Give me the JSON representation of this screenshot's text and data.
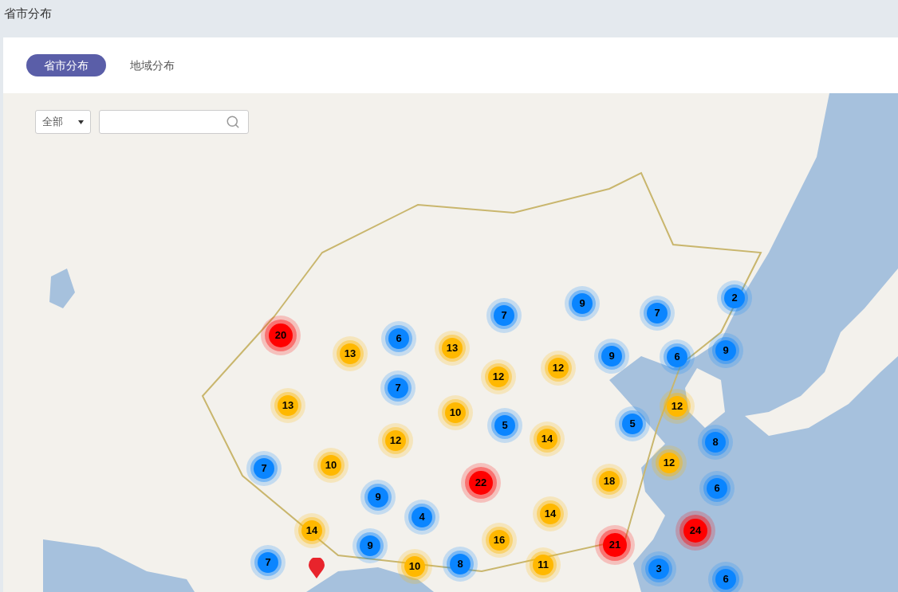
{
  "page_title": "省市分布",
  "tabs": [
    {
      "label": "省市分布",
      "selected": true
    },
    {
      "label": "地域分布",
      "selected": false
    }
  ],
  "map": {
    "region_select": "全部",
    "clusters": [
      {
        "count": "9",
        "color": "#0a85ff"
      },
      {
        "count": "7",
        "color": "#0a85ff"
      },
      {
        "count": "2",
        "color": "#0a85ff"
      },
      {
        "count": "7",
        "color": "#0a85ff"
      },
      {
        "count": "20",
        "color": "#ff0000"
      },
      {
        "count": "6",
        "color": "#0a85ff"
      },
      {
        "count": "13",
        "color": "#ffb800"
      },
      {
        "count": "13",
        "color": "#ffb800"
      },
      {
        "count": "9",
        "color": "#0a85ff"
      },
      {
        "count": "6",
        "color": "#0a85ff"
      },
      {
        "count": "9",
        "color": "#0a85ff"
      },
      {
        "count": "12",
        "color": "#ffb800"
      },
      {
        "count": "12",
        "color": "#ffb800"
      },
      {
        "count": "7",
        "color": "#0a85ff"
      },
      {
        "count": "13",
        "color": "#ffb800"
      },
      {
        "count": "10",
        "color": "#ffb800"
      },
      {
        "count": "12",
        "color": "#ffb800"
      },
      {
        "count": "5",
        "color": "#0a85ff"
      },
      {
        "count": "5",
        "color": "#0a85ff"
      },
      {
        "count": "12",
        "color": "#ffb800"
      },
      {
        "count": "14",
        "color": "#ffb800"
      },
      {
        "count": "8",
        "color": "#0a85ff"
      },
      {
        "count": "12",
        "color": "#ffb800"
      },
      {
        "count": "7",
        "color": "#0a85ff"
      },
      {
        "count": "10",
        "color": "#ffb800"
      },
      {
        "count": "22",
        "color": "#ff0000"
      },
      {
        "count": "18",
        "color": "#ffb800"
      },
      {
        "count": "6",
        "color": "#0a85ff"
      },
      {
        "count": "9",
        "color": "#0a85ff"
      },
      {
        "count": "4",
        "color": "#0a85ff"
      },
      {
        "count": "14",
        "color": "#ffb800"
      },
      {
        "count": "14",
        "color": "#ffb800"
      },
      {
        "count": "24",
        "color": "#ff0000"
      },
      {
        "count": "9",
        "color": "#0a85ff"
      },
      {
        "count": "16",
        "color": "#ffb800"
      },
      {
        "count": "21",
        "color": "#ff0000"
      },
      {
        "count": "7",
        "color": "#0a85ff"
      },
      {
        "count": "10",
        "color": "#ffb800"
      },
      {
        "count": "8",
        "color": "#0a85ff"
      },
      {
        "count": "11",
        "color": "#ffb800"
      },
      {
        "count": "3",
        "color": "#0a85ff"
      },
      {
        "count": "6",
        "color": "#0a85ff"
      }
    ]
  }
}
